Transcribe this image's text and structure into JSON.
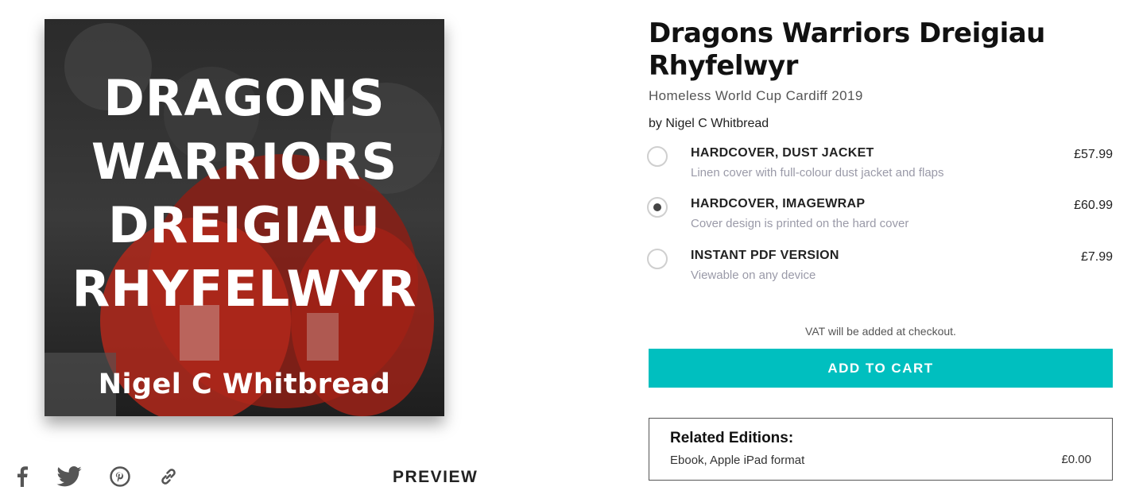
{
  "cover": {
    "title_lines": [
      "DRAGONS",
      "WARRIORS",
      "DREIGIAU",
      "RHYFELWYR"
    ],
    "author": "Nigel C Whitbread"
  },
  "share": {
    "icons": [
      "facebook-icon",
      "twitter-icon",
      "pinterest-icon",
      "link-icon"
    ]
  },
  "preview_label": "PREVIEW",
  "product": {
    "title": "Dragons Warriors Dreigiau Rhyfelwyr",
    "subtitle": "Homeless World Cup Cardiff 2019",
    "byline": "by Nigel C Whitbread"
  },
  "options": [
    {
      "name": "HARDCOVER, DUST JACKET",
      "desc": "Linen cover with full-colour dust jacket and flaps",
      "price": "£57.99",
      "selected": false
    },
    {
      "name": "HARDCOVER, IMAGEWRAP",
      "desc": "Cover design is printed on the hard cover",
      "price": "£60.99",
      "selected": true
    },
    {
      "name": "INSTANT PDF VERSION",
      "desc": "Viewable on any device",
      "price": "£7.99",
      "selected": false
    }
  ],
  "vat_note": "VAT will be added at checkout.",
  "cart_label": "ADD TO CART",
  "related": {
    "heading": "Related Editions:",
    "items": [
      {
        "label": "Ebook, Apple iPad format",
        "price": "£0.00"
      }
    ]
  },
  "colors": {
    "accent": "#00bfbf",
    "cover_bg": "#1a1a1a",
    "jersey_red": "#c0281c"
  }
}
